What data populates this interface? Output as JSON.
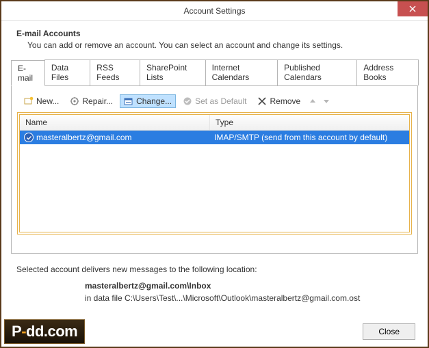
{
  "window": {
    "title": "Account Settings"
  },
  "header": {
    "title": "E-mail Accounts",
    "desc": "You can add or remove an account. You can select an account and change its settings."
  },
  "tabs": [
    {
      "label": "E-mail"
    },
    {
      "label": "Data Files"
    },
    {
      "label": "RSS Feeds"
    },
    {
      "label": "SharePoint Lists"
    },
    {
      "label": "Internet Calendars"
    },
    {
      "label": "Published Calendars"
    },
    {
      "label": "Address Books"
    }
  ],
  "toolbar": {
    "new_label": "New...",
    "repair_label": "Repair...",
    "change_label": "Change...",
    "default_label": "Set as Default",
    "remove_label": "Remove"
  },
  "columns": {
    "name": "Name",
    "type": "Type"
  },
  "rows": [
    {
      "name": "masteralbertz@gmail.com",
      "type": "IMAP/SMTP (send from this account by default)"
    }
  ],
  "location": {
    "intro": "Selected account delivers new messages to the following location:",
    "path_bold": "masteralbertz@gmail.com\\Inbox",
    "path_detail": "in data file C:\\Users\\Test\\...\\Microsoft\\Outlook\\masteralbertz@gmail.com.ost"
  },
  "footer": {
    "close": "Close"
  },
  "watermark": {
    "p": "P",
    "dash": "-",
    "rest": "dd.com"
  }
}
